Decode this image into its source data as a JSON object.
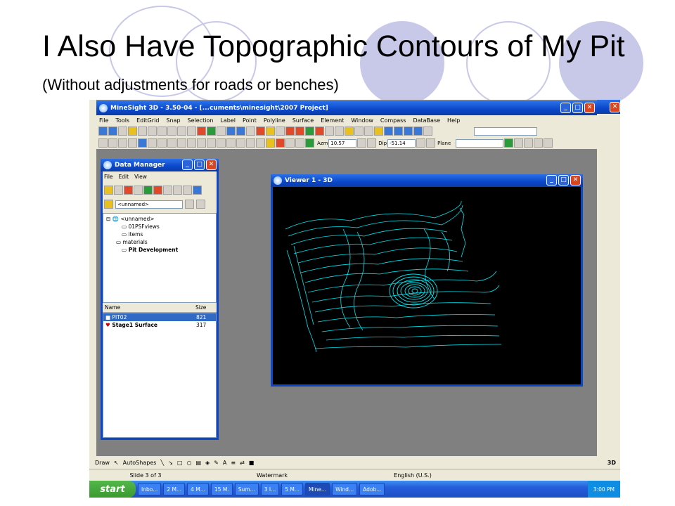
{
  "slide": {
    "title_main": "I Also Have Topographic Contours of My Pit",
    "title_sub": "(Without adjustments for roads or benches)"
  },
  "app": {
    "title": "MineSight 3D  - 3.50-04 - [...cuments\\minesight\\2007 Project]",
    "menu": [
      "File",
      "Tools",
      "EditGrid",
      "Snap",
      "Selection",
      "Label",
      "Point",
      "Polyline",
      "Surface",
      "Element",
      "Window",
      "Compass",
      "DataBase",
      "Help"
    ],
    "azm_label": "Azm",
    "azm_value": "10.57",
    "dip_label": "Dip",
    "dip_value": "-51.14",
    "plane_label": "Plane"
  },
  "data_manager": {
    "title": "Data Manager",
    "menu": [
      "File",
      "Edit",
      "View"
    ],
    "object_value": "<unnamed>",
    "tree": [
      "<unnamed>",
      "01PSFviews",
      "items",
      "materials",
      "Pit Development"
    ],
    "col_name": "Name",
    "col_size": "Size",
    "rows": [
      {
        "name": "PIT02",
        "size": "821"
      },
      {
        "name": "Stage1 Surface",
        "size": "317"
      }
    ]
  },
  "viewer": {
    "title": "Viewer 1 - 3D"
  },
  "powerpoint": {
    "draw_label": "Draw",
    "autoshapes_label": "AutoShapes",
    "status_slide": "Slide 3 of 3",
    "status_design": "Watermark",
    "status_lang": "English (U.S.)",
    "logo_text": "3D"
  },
  "taskbar": {
    "start_label": "start",
    "items": [
      "Inbo...",
      "2 M...",
      "4 M...",
      "15 M.",
      "Sum...",
      "3 I...",
      "5 M...",
      "Mine...",
      "Wind...",
      "Adob..."
    ],
    "active_index": 7,
    "clock": "3:00 PM"
  },
  "colors": {
    "contour": "#00e5ee",
    "circle": "#c8c8e8",
    "xp_blue": "#0a47c9"
  }
}
